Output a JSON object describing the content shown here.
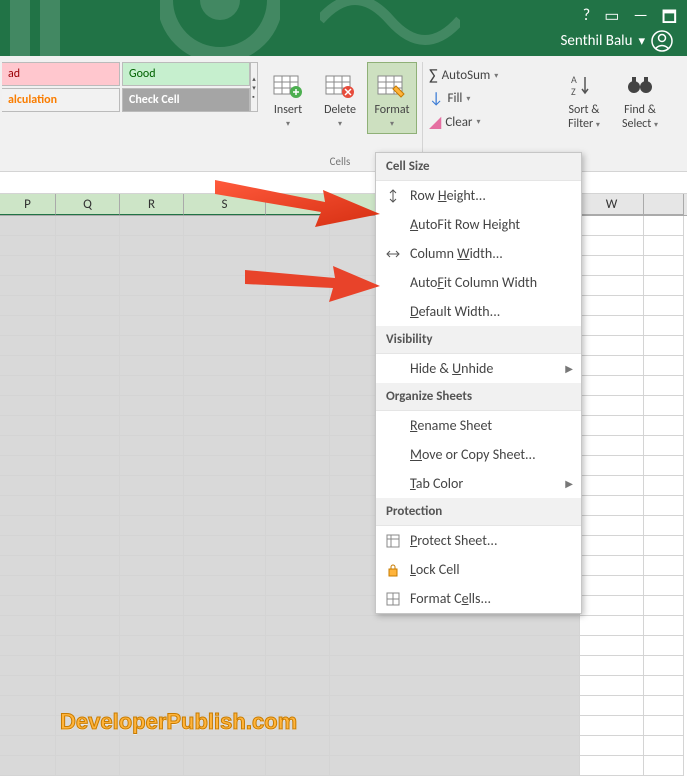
{
  "titlebar": {
    "user": "Senthil Balu",
    "help": "?"
  },
  "ribbon": {
    "styles": {
      "bad": "ad",
      "good": "Good",
      "calculation": "alculation",
      "check_cell": "Check Cell"
    },
    "cells": {
      "insert": "Insert",
      "delete": "Delete",
      "format": "Format",
      "group_label": "Cells"
    },
    "editing": {
      "autosum": "AutoSum",
      "fill": "Fill",
      "clear": "Clear"
    },
    "sortfilter": {
      "line1": "Sort &",
      "line2": "Filter"
    },
    "findselect": {
      "line1": "Find &",
      "line2": "Select"
    }
  },
  "columns": [
    "P",
    "Q",
    "R",
    "S",
    "",
    "",
    "W"
  ],
  "menu": {
    "sections": {
      "cell_size": "Cell Size",
      "visibility": "Visibility",
      "organize": "Organize Sheets",
      "protection": "Protection"
    },
    "items": {
      "row_height": "Row Height...",
      "autofit_row": "AutoFit Row Height",
      "column_width": "Column Width...",
      "autofit_col": "AutoFit Column Width",
      "default_width": "Default Width...",
      "hide_unhide": "Hide & Unhide",
      "rename_sheet": "Rename Sheet",
      "move_copy": "Move or Copy Sheet...",
      "tab_color": "Tab Color",
      "protect_sheet": "Protect Sheet...",
      "lock_cell": "Lock Cell",
      "format_cells": "Format Cells..."
    }
  },
  "watermark": "DeveloperPublish.com"
}
